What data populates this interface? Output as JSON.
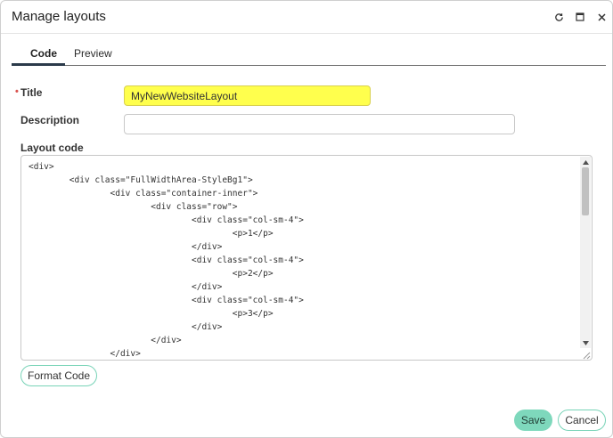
{
  "dialog": {
    "title": "Manage layouts"
  },
  "tabs": [
    {
      "label": "Code",
      "active": true
    },
    {
      "label": "Preview",
      "active": false
    }
  ],
  "form": {
    "title_label": "Title",
    "required_mark": "•",
    "title_value": "MyNewWebsiteLayout",
    "description_label": "Description",
    "description_value": "",
    "layout_code_label": "Layout code"
  },
  "code_lines": [
    "<div>",
    "        <div class=\"FullWidthArea-StyleBg1\">",
    "                <div class=\"container-inner\">",
    "                        <div class=\"row\">",
    "                                <div class=\"col-sm-4\">",
    "                                        <p>1</p>",
    "                                </div>",
    "                                <div class=\"col-sm-4\">",
    "                                        <p>2</p>",
    "                                </div>",
    "                                <div class=\"col-sm-4\">",
    "                                        <p>3</p>",
    "                                </div>",
    "                        </div>",
    "                </div>"
  ],
  "buttons": {
    "format_code": "Format Code",
    "save": "Save",
    "cancel": "Cancel"
  },
  "icons": {
    "refresh": "refresh-icon",
    "maximize": "maximize-icon",
    "close": "close-icon"
  },
  "colors": {
    "accent": "#7ed8bc",
    "accent_border": "#78d3b7",
    "highlight": "#ffff4d",
    "required": "#d9534f"
  }
}
